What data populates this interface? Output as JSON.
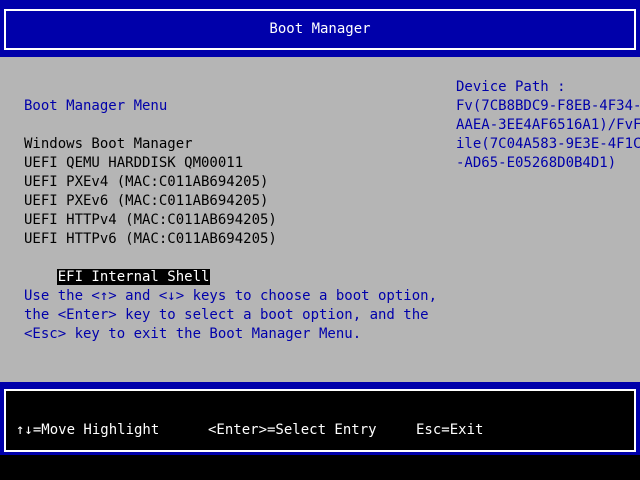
{
  "header": {
    "title": "Boot Manager"
  },
  "menu": {
    "title": "Boot Manager Menu",
    "items": [
      {
        "label": "Windows Boot Manager"
      },
      {
        "label": "UEFI QEMU HARDDISK QM00011"
      },
      {
        "label": "UEFI PXEv4 (MAC:C011AB694205)"
      },
      {
        "label": "UEFI PXEv6 (MAC:C011AB694205)"
      },
      {
        "label": "UEFI HTTPv4 (MAC:C011AB694205)"
      },
      {
        "label": "UEFI HTTPv6 (MAC:C011AB694205)"
      },
      {
        "label": "EFI Internal Shell"
      }
    ],
    "selected": "EFI Internal Shell",
    "help_lines": [
      "Use the <↑> and <↓> keys to choose a boot option,",
      "the <Enter> key to select a boot option, and the",
      "<Esc> key to exit the Boot Manager Menu."
    ]
  },
  "device_path": {
    "label": "Device Path :",
    "lines": [
      "Fv(7CB8BDC9-F8EB-4F34-",
      "AAEA-3EE4AF6516A1)/FvF",
      "ile(7C04A583-9E3E-4F1C",
      "-AD65-E05268D0B4D1)"
    ]
  },
  "footer": {
    "move": "↑↓=Move Highlight",
    "select": "<Enter>=Select Entry",
    "exit": "Esc=Exit"
  },
  "colors": {
    "frame_blue": "#0000aa",
    "body_gray": "#b5b5b5",
    "highlight_bg": "#000000",
    "highlight_fg": "#ffffff"
  }
}
